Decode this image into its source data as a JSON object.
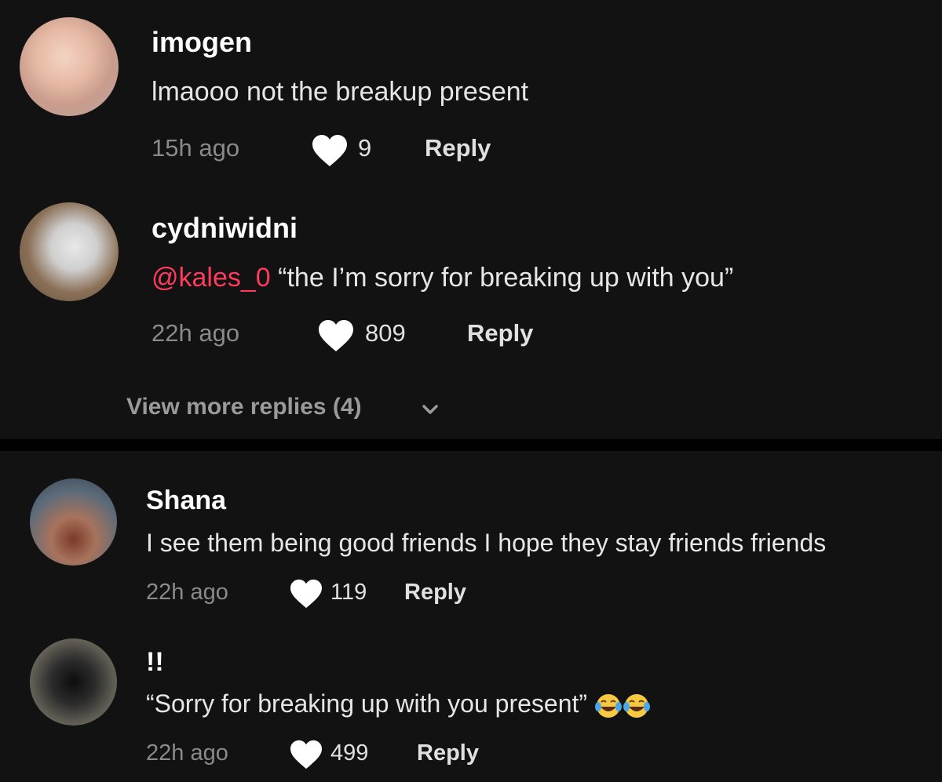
{
  "comments_top": [
    {
      "username": "imogen",
      "text": "lmaooo not the breakup present",
      "time": "15h ago",
      "likes": "9",
      "reply_label": "Reply"
    },
    {
      "username": "cydniwidni",
      "mention": "@kales_0",
      "text": " “the I’m sorry for breaking up with you”",
      "time": "22h ago",
      "likes": "809",
      "reply_label": "Reply"
    }
  ],
  "view_more_replies": "View more replies (4)",
  "comments_bottom": [
    {
      "username": "Shana",
      "text": "I see them being good friends I hope they stay friends friends",
      "time": "22h ago",
      "likes": "119",
      "reply_label": "Reply"
    },
    {
      "username": "!!",
      "text": "“Sorry for breaking up with you present” ",
      "time": "22h ago",
      "likes": "499",
      "reply_label": "Reply",
      "emoji": "face-with-tears-of-joy x2"
    }
  ],
  "colors": {
    "background": "#121212",
    "mention": "#ff3b5c",
    "muted": "#8a8a8a"
  },
  "icons": [
    "heart-icon",
    "chevron-down-icon",
    "tears-of-joy-emoji"
  ]
}
